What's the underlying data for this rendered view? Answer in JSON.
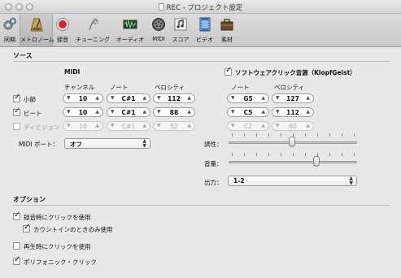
{
  "window": {
    "title": "REC - プロジェクト設定"
  },
  "toolbar": {
    "items": [
      {
        "label": "同期",
        "icon": "sync-icon"
      },
      {
        "label": "メトロノーム",
        "icon": "metronome-icon",
        "selected": true
      },
      {
        "label": "録音",
        "icon": "record-icon"
      },
      {
        "label": "チューニング",
        "icon": "tuning-fork-icon"
      },
      {
        "label": "オーディオ",
        "icon": "audio-waveform-icon"
      },
      {
        "label": "MIDI",
        "icon": "midi-connector-icon"
      },
      {
        "label": "スコア",
        "icon": "score-icon"
      },
      {
        "label": "ビデオ",
        "icon": "video-icon"
      },
      {
        "label": "素材",
        "icon": "assets-icon"
      }
    ]
  },
  "source": {
    "section_title": "ソース",
    "midi_header": "MIDI",
    "col_channel": "チャンネル",
    "col_note": "ノート",
    "col_velocity": "ベロシティ",
    "software_click": {
      "label": "ソフトウェアクリック音源（KlopfGeist）",
      "checked": true
    },
    "sw_col_note": "ノート",
    "sw_col_velocity": "ベロシティ",
    "rows": [
      {
        "label": "小節",
        "checked": true,
        "enabled": true,
        "channel": "10",
        "note": "C#1",
        "velocity": "112",
        "sw_note": "G5",
        "sw_velocity": "127"
      },
      {
        "label": "ビート",
        "checked": true,
        "enabled": true,
        "channel": "10",
        "note": "C#1",
        "velocity": "88",
        "sw_note": "C5",
        "sw_velocity": "112"
      },
      {
        "label": "ディビジョン",
        "checked": false,
        "enabled": false,
        "channel": "10",
        "note": "C#1",
        "velocity": "52",
        "sw_note": "C2",
        "sw_velocity": "60"
      }
    ],
    "midi_port_label": "MIDI ポート：",
    "midi_port_value": "オフ",
    "tonality_label": "調性：",
    "tonality_level": 0.5,
    "volume_label": "音量：",
    "volume_level": 0.7,
    "output_label": "出力：",
    "output_value": "1-2"
  },
  "options": {
    "section_title": "オプション",
    "items": [
      {
        "label": "録音時にクリックを使用",
        "checked": true
      },
      {
        "label": "カウントインのときのみ使用",
        "checked": true
      },
      {
        "label": "再生時にクリックを使用",
        "checked": false
      },
      {
        "label": "ポリフォニック・クリック",
        "checked": true
      }
    ]
  }
}
